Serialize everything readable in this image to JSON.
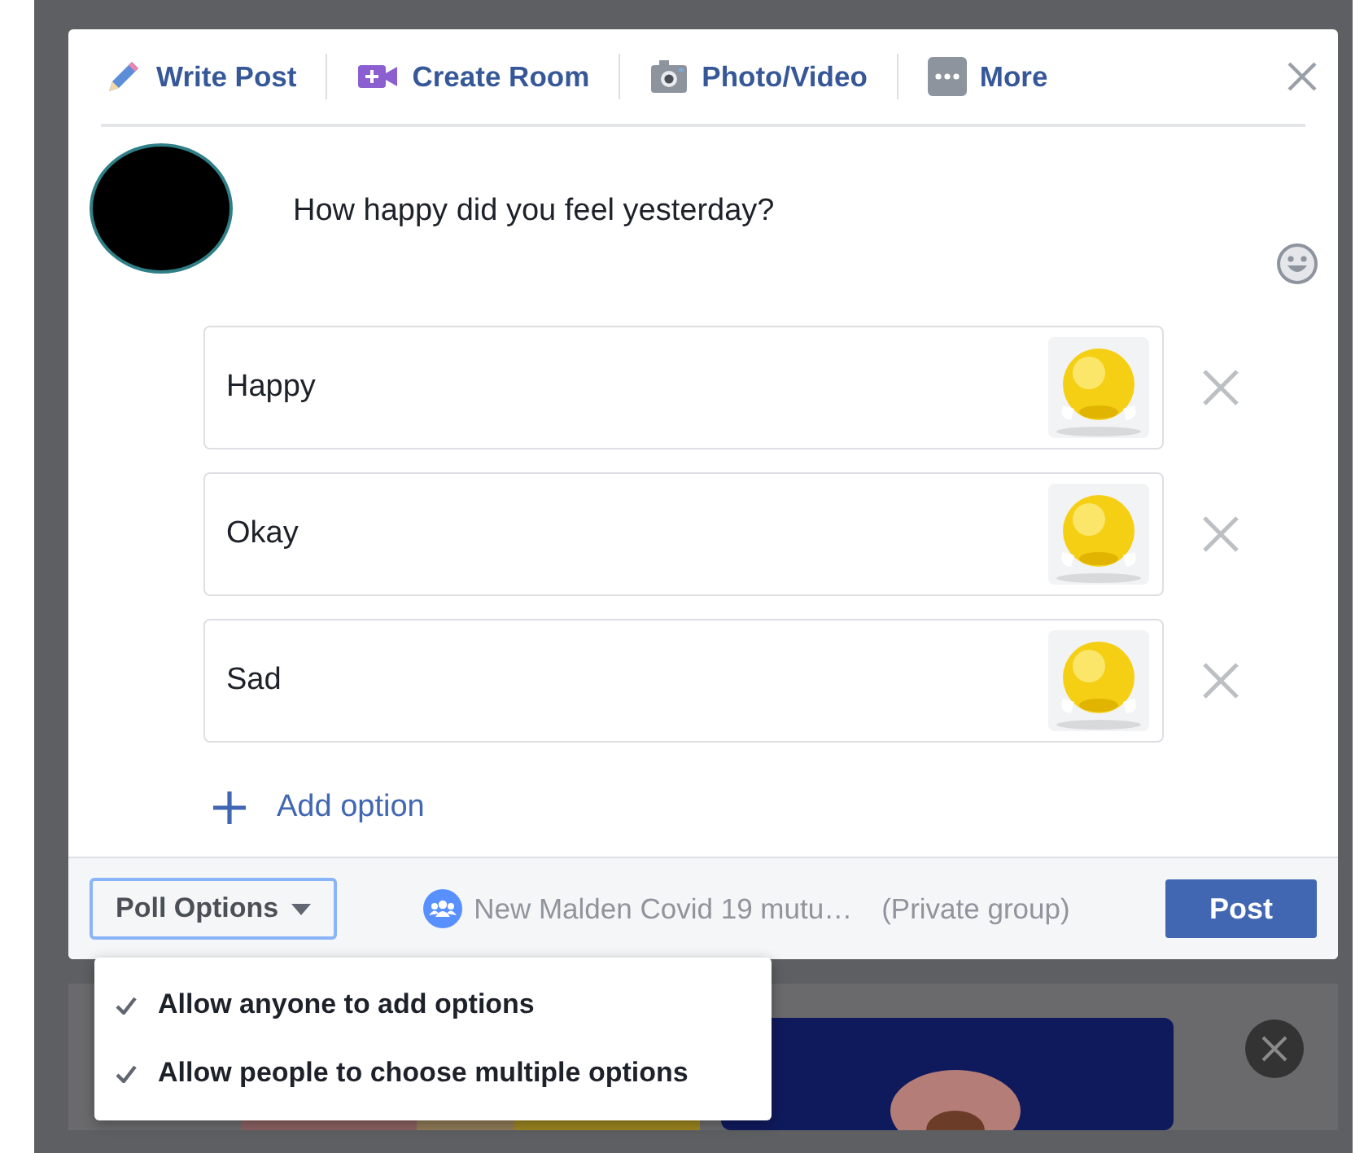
{
  "composer_tabs": [
    {
      "label": "Write Post",
      "kind": "pencil"
    },
    {
      "label": "Create Room",
      "kind": "video"
    },
    {
      "label": "Photo/Video",
      "kind": "camera"
    },
    {
      "label": "More",
      "kind": "more"
    }
  ],
  "question": "How happy did you feel yesterday?",
  "options": [
    {
      "label": "Happy",
      "kind": "picture"
    },
    {
      "label": "Okay",
      "kind": "picture"
    },
    {
      "label": "Sad",
      "kind": "picture"
    }
  ],
  "add_option": "Add option",
  "footer": {
    "poll_options": "Poll Options",
    "group_name": "New Malden Covid 19 mutu…",
    "privacy": "(Private group)",
    "post": "Post"
  },
  "poll_menu": [
    {
      "label": "Allow anyone to add options",
      "checked": true
    },
    {
      "label": "Allow people to choose multiple options",
      "checked": true
    }
  ]
}
